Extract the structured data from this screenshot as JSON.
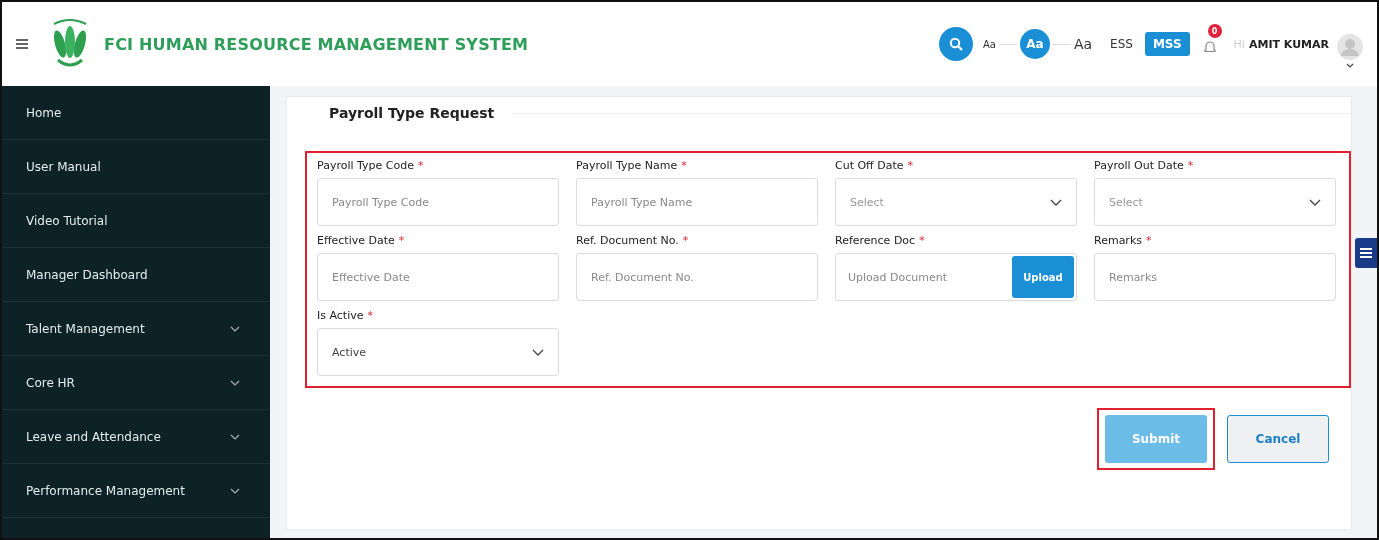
{
  "header": {
    "title": "FCI HUMAN RESOURCE MANAGEMENT SYSTEM",
    "font_sizes": [
      {
        "label": "Aa",
        "selected": false
      },
      {
        "label": "Aa",
        "selected": true
      },
      {
        "label": "Aa",
        "selected": false
      }
    ],
    "modes": [
      {
        "label": "ESS",
        "selected": false
      },
      {
        "label": "MSS",
        "selected": true
      }
    ],
    "notification_count": "0",
    "greeting": "Hi",
    "user_name": "AMIT KUMAR"
  },
  "sidebar": {
    "items": [
      {
        "label": "Home",
        "expandable": false
      },
      {
        "label": "User Manual",
        "expandable": false
      },
      {
        "label": "Video Tutorial",
        "expandable": false
      },
      {
        "label": "Manager Dashboard",
        "expandable": false
      },
      {
        "label": "Talent Management",
        "expandable": true
      },
      {
        "label": "Core HR",
        "expandable": true
      },
      {
        "label": "Leave and Attendance",
        "expandable": true
      },
      {
        "label": "Performance Management",
        "expandable": true
      }
    ]
  },
  "form": {
    "title": "Payroll Type Request",
    "highlighted": true,
    "fields": [
      {
        "kind": "text",
        "label": "Payroll Type Code",
        "required_mark": "*",
        "placeholder": "Payroll Type Code"
      },
      {
        "kind": "text",
        "label": "Payroll Type Name",
        "required_mark": "*",
        "placeholder": "Payroll Type Name"
      },
      {
        "kind": "select",
        "label": "Cut Off Date",
        "required_mark": "*",
        "placeholder": "Select"
      },
      {
        "kind": "select",
        "label": "Payroll Out Date",
        "required_mark": "*",
        "placeholder": "Select"
      },
      {
        "kind": "text",
        "label": "Effective Date",
        "required_mark": "*",
        "placeholder": "Effective Date"
      },
      {
        "kind": "text",
        "label": "Ref. Document No.",
        "required_mark": "*",
        "placeholder": "Ref. Document No."
      },
      {
        "kind": "upload",
        "label": "Reference Doc",
        "required_mark": "*",
        "placeholder": "Upload Document",
        "button": "Upload"
      },
      {
        "kind": "text",
        "label": "Remarks",
        "required_mark": "*",
        "placeholder": "Remarks"
      },
      {
        "kind": "select",
        "label": "Is Active",
        "required_mark": "*",
        "value": "Active"
      }
    ],
    "buttons": [
      {
        "label": "Submit",
        "kind": "primary",
        "highlighted": true
      },
      {
        "label": "Cancel",
        "kind": "secondary",
        "highlighted": false
      }
    ]
  }
}
